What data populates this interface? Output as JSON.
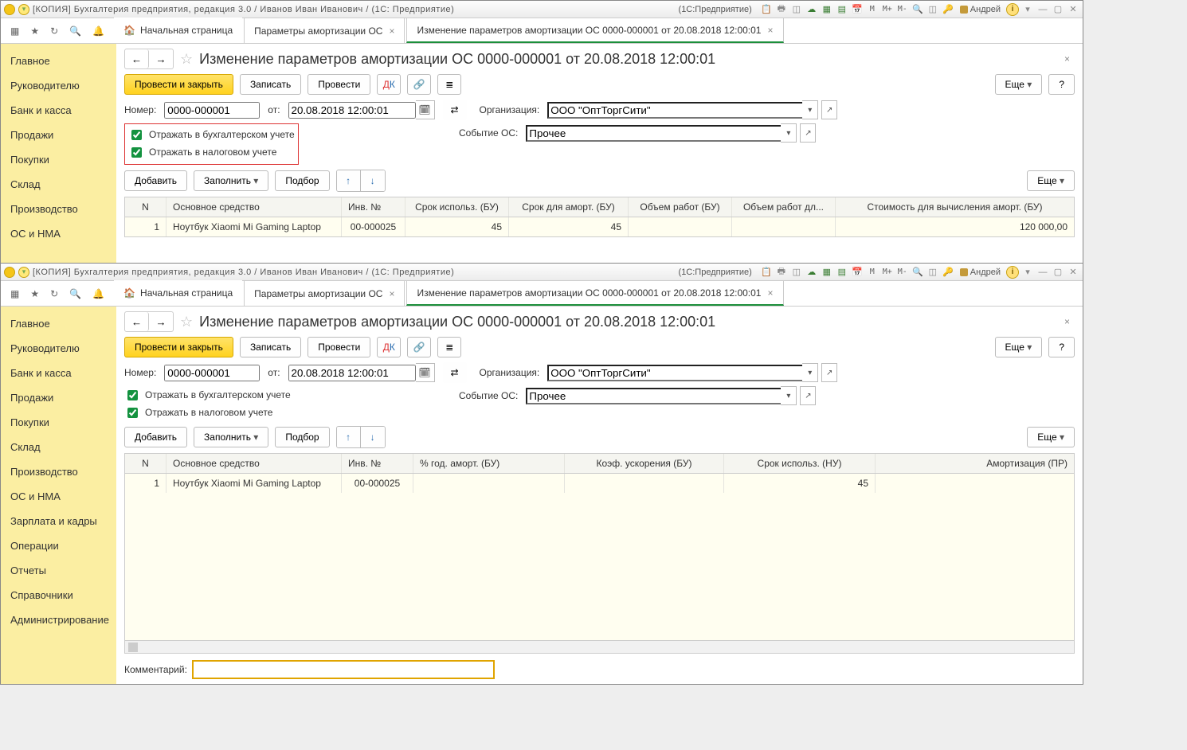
{
  "titlebar": {
    "title": "[КОПИЯ] Бухгалтерия предприятия, редакция 3.0 / Иванов Иван Иванович / (1С: Предприятие)",
    "suffix": "(1С:Предприятие)",
    "user": "Андрей"
  },
  "tabs": {
    "home": "Начальная страница",
    "t1": "Параметры амортизации ОС",
    "t2": "Изменение параметров амортизации ОС 0000-000001 от 20.08.2018 12:00:01"
  },
  "sidebar": {
    "items": [
      {
        "label": "Главное"
      },
      {
        "label": "Руководителю"
      },
      {
        "label": "Банк и касса"
      },
      {
        "label": "Продажи"
      },
      {
        "label": "Покупки"
      },
      {
        "label": "Склад"
      },
      {
        "label": "Производство"
      },
      {
        "label": "ОС и НМА"
      },
      {
        "label": "Зарплата и кадры"
      },
      {
        "label": "Операции"
      },
      {
        "label": "Отчеты"
      },
      {
        "label": "Справочники"
      },
      {
        "label": "Администрирование"
      }
    ]
  },
  "page": {
    "title": "Изменение параметров амортизации ОС 0000-000001 от 20.08.2018 12:00:01"
  },
  "cmd": {
    "post_close": "Провести и закрыть",
    "write": "Записать",
    "post": "Провести",
    "more": "Еще",
    "help": "?",
    "add": "Добавить",
    "fill": "Заполнить",
    "pick": "Подбор"
  },
  "form": {
    "number_label": "Номер:",
    "number": "0000-000001",
    "date_label": "от:",
    "date": "20.08.2018 12:00:01",
    "org_label": "Организация:",
    "org": "ООО \"ОптТоргСити\"",
    "event_label": "Событие ОС:",
    "event": "Прочее",
    "chk_bu": "Отражать в бухгалтерском учете",
    "chk_nu": "Отражать в налоговом учете"
  },
  "grid1": {
    "head": [
      "N",
      "Основное средство",
      "Инв. №",
      "Срок использ. (БУ)",
      "Срок для аморт. (БУ)",
      "Объем работ (БУ)",
      "Объем работ дл...",
      "Стоимость для вычисления аморт. (БУ)"
    ],
    "row": {
      "n": "1",
      "name": "Ноутбук Xiaomi Mi Gaming Laptop",
      "inv": "00-000025",
      "srokBU": "45",
      "srokAmBU": "45",
      "vol1": "",
      "vol2": "",
      "cost": "120 000,00"
    }
  },
  "grid2": {
    "head": [
      "N",
      "Основное средство",
      "Инв. №",
      "% год.  аморт. (БУ)",
      "Коэф. ускорения (БУ)",
      "Срок использ. (НУ)",
      "Амортизация (ПР)"
    ],
    "row": {
      "n": "1",
      "name": "Ноутбук Xiaomi Mi Gaming Laptop",
      "inv": "00-000025",
      "pct": "",
      "koef": "",
      "srokNU": "45",
      "amort": ""
    }
  },
  "comment": {
    "label": "Комментарий:"
  },
  "tm": {
    "M": "M",
    "Mp": "M+",
    "Mm": "M-"
  }
}
